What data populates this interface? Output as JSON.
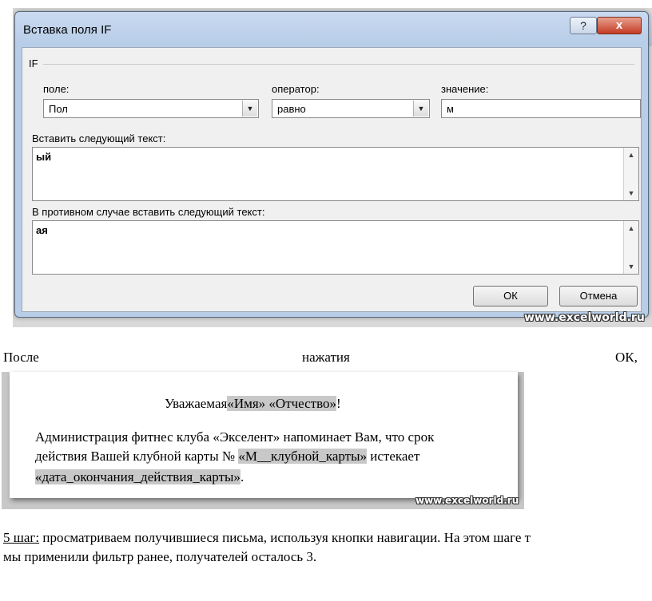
{
  "dialog": {
    "title": "Вставка поля IF",
    "help_label": "?",
    "close_label": "x",
    "group_label": "IF",
    "field_label": "поле:",
    "field_value": "Пол",
    "operator_label": "оператор:",
    "operator_value": "равно",
    "value_label": "значение:",
    "value_value": "м",
    "insert_text_label": "Вставить следующий текст:",
    "insert_text_value": "ый",
    "else_text_label": "В противном случае вставить следующий текст:",
    "else_text_value": "ая",
    "ok_label": "ОК",
    "cancel_label": "Отмена"
  },
  "watermark": "www.excelworld.ru",
  "after_line": {
    "w1": "После",
    "w2": "нажатия",
    "w3": "ОК,"
  },
  "letter": {
    "greeting_prefix": "Уважаемая",
    "greeting_fields": "«Имя» «Отчество»",
    "greeting_suffix": "!",
    "line1": "Администрация фитнес клуба «Экселент» напоминает Вам, что срок",
    "line2_prefix": "действия Вашей клубной карты №",
    "line2_field": "«М__клубной_карты»",
    "line2_suffix": "истекает",
    "line3_field": "«дата_окончания_действия_карты»",
    "line3_suffix": "."
  },
  "step": {
    "label": "5 шаг:",
    "line1_rest": " просматриваем получившиеся письма, используя кнопки навигации. На этом шаге т",
    "line2": "мы применили фильтр ранее, получателей осталось 3."
  }
}
